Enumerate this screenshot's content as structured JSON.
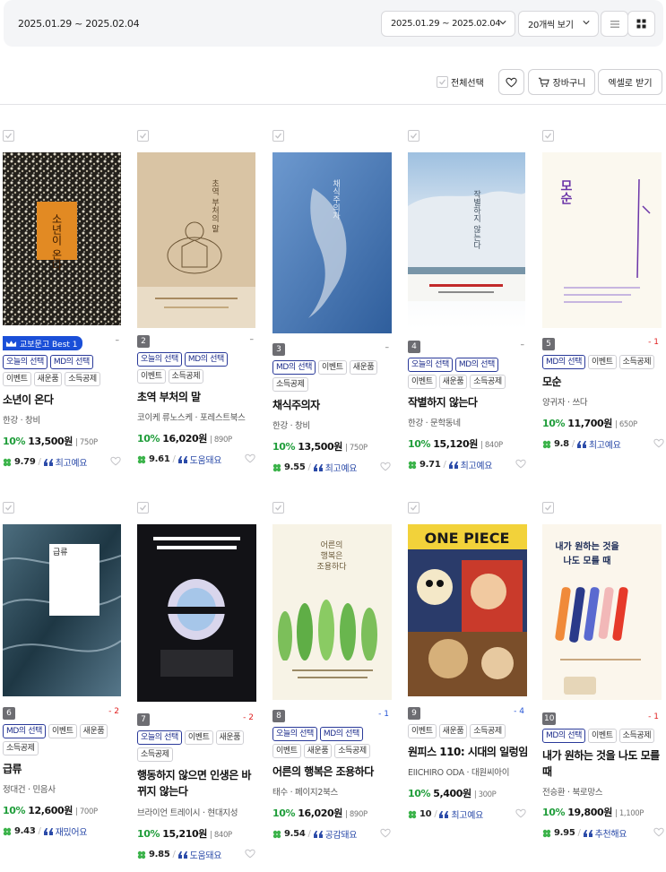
{
  "filter": {
    "date_label": "2025.01.29 ~ 2025.02.04",
    "date_select": "2025.01.29 ~ 2025.02.04",
    "page_size": "20개씩 보기"
  },
  "actions": {
    "select_all": "전체선택",
    "cart": "장바구니",
    "excel": "엑셀로 받기"
  },
  "best_badge": "교보문고 Best 1",
  "colors": {
    "accent": "#1a4fd8",
    "discount": "#1f9d3a",
    "rank_up": "#e02020",
    "rank_down": "#2454d6"
  },
  "books": [
    {
      "rank": "1",
      "change": "–",
      "tags": [
        "오늘의 선택",
        "MD의 선택",
        "이벤트",
        "새운품",
        "소득공제"
      ],
      "title": "소년이 온다",
      "author": "한강 · 창비",
      "discount": "10%",
      "price": "13,500원",
      "points": "750P",
      "score": "9.79",
      "review": "최고예요"
    },
    {
      "rank": "2",
      "change": "–",
      "tags": [
        "오늘의 선택",
        "MD의 선택",
        "이벤트",
        "소득공제"
      ],
      "title": "초역 부처의 말",
      "author": "코이케 류노스케 · 포레스트북스",
      "discount": "10%",
      "price": "16,020원",
      "points": "890P",
      "score": "9.61",
      "review": "도움돼요"
    },
    {
      "rank": "3",
      "change": "–",
      "tags": [
        "MD의 선택",
        "이벤트",
        "새운품",
        "소득공제"
      ],
      "title": "채식주의자",
      "author": "한강 · 창비",
      "discount": "10%",
      "price": "13,500원",
      "points": "750P",
      "score": "9.55",
      "review": "최고예요"
    },
    {
      "rank": "4",
      "change": "–",
      "tags": [
        "오늘의 선택",
        "MD의 선택",
        "이벤트",
        "새운품",
        "소득공제"
      ],
      "title": "작별하지 않는다",
      "author": "한강 · 문학동네",
      "discount": "10%",
      "price": "15,120원",
      "points": "840P",
      "score": "9.71",
      "review": "최고예요"
    },
    {
      "rank": "5",
      "change": "- 1",
      "tags": [
        "MD의 선택",
        "이벤트",
        "소득공제"
      ],
      "title": "모순",
      "author": "양귀자 · 쓰다",
      "discount": "10%",
      "price": "11,700원",
      "points": "650P",
      "score": "9.8",
      "review": "최고예요"
    },
    {
      "rank": "6",
      "change": "- 2",
      "tags": [
        "MD의 선택",
        "이벤트",
        "새운품",
        "소득공제"
      ],
      "title": "급류",
      "author": "정대건 · 민음사",
      "discount": "10%",
      "price": "12,600원",
      "points": "700P",
      "score": "9.43",
      "review": "재밌어요"
    },
    {
      "rank": "7",
      "change": "- 2",
      "tags": [
        "오늘의 선택",
        "이벤트",
        "새운품",
        "소득공제"
      ],
      "title": "행동하지 않으면 인생은 바뀌지 않는다",
      "author": "브라이언 트레이시 · 현대지성",
      "discount": "10%",
      "price": "15,210원",
      "points": "840P",
      "score": "9.85",
      "review": "도움돼요"
    },
    {
      "rank": "8",
      "change": "- 1",
      "tags": [
        "오늘의 선택",
        "MD의 선택",
        "이벤트",
        "새운품",
        "소득공제"
      ],
      "title": "어른의 행복은 조용하다",
      "author": "태수 · 페이지2북스",
      "discount": "10%",
      "price": "16,020원",
      "points": "890P",
      "score": "9.54",
      "review": "공감돼요"
    },
    {
      "rank": "9",
      "change": "- 4",
      "tags": [
        "이벤트",
        "새운품",
        "소득공제"
      ],
      "title": "원피스 110: 시대의 일렁임",
      "author": "EIICHIRO ODA · 대원씨아이",
      "discount": "10%",
      "price": "5,400원",
      "points": "300P",
      "score": "10",
      "review": "최고예요"
    },
    {
      "rank": "10",
      "change": "- 1",
      "tags": [
        "MD의 선택",
        "이벤트",
        "소득공제"
      ],
      "title": "내가 원하는 것을 나도 모를 때",
      "author": "전승환 · 북로망스",
      "discount": "10%",
      "price": "19,800원",
      "points": "1,100P",
      "score": "9.95",
      "review": "추천해요"
    }
  ]
}
